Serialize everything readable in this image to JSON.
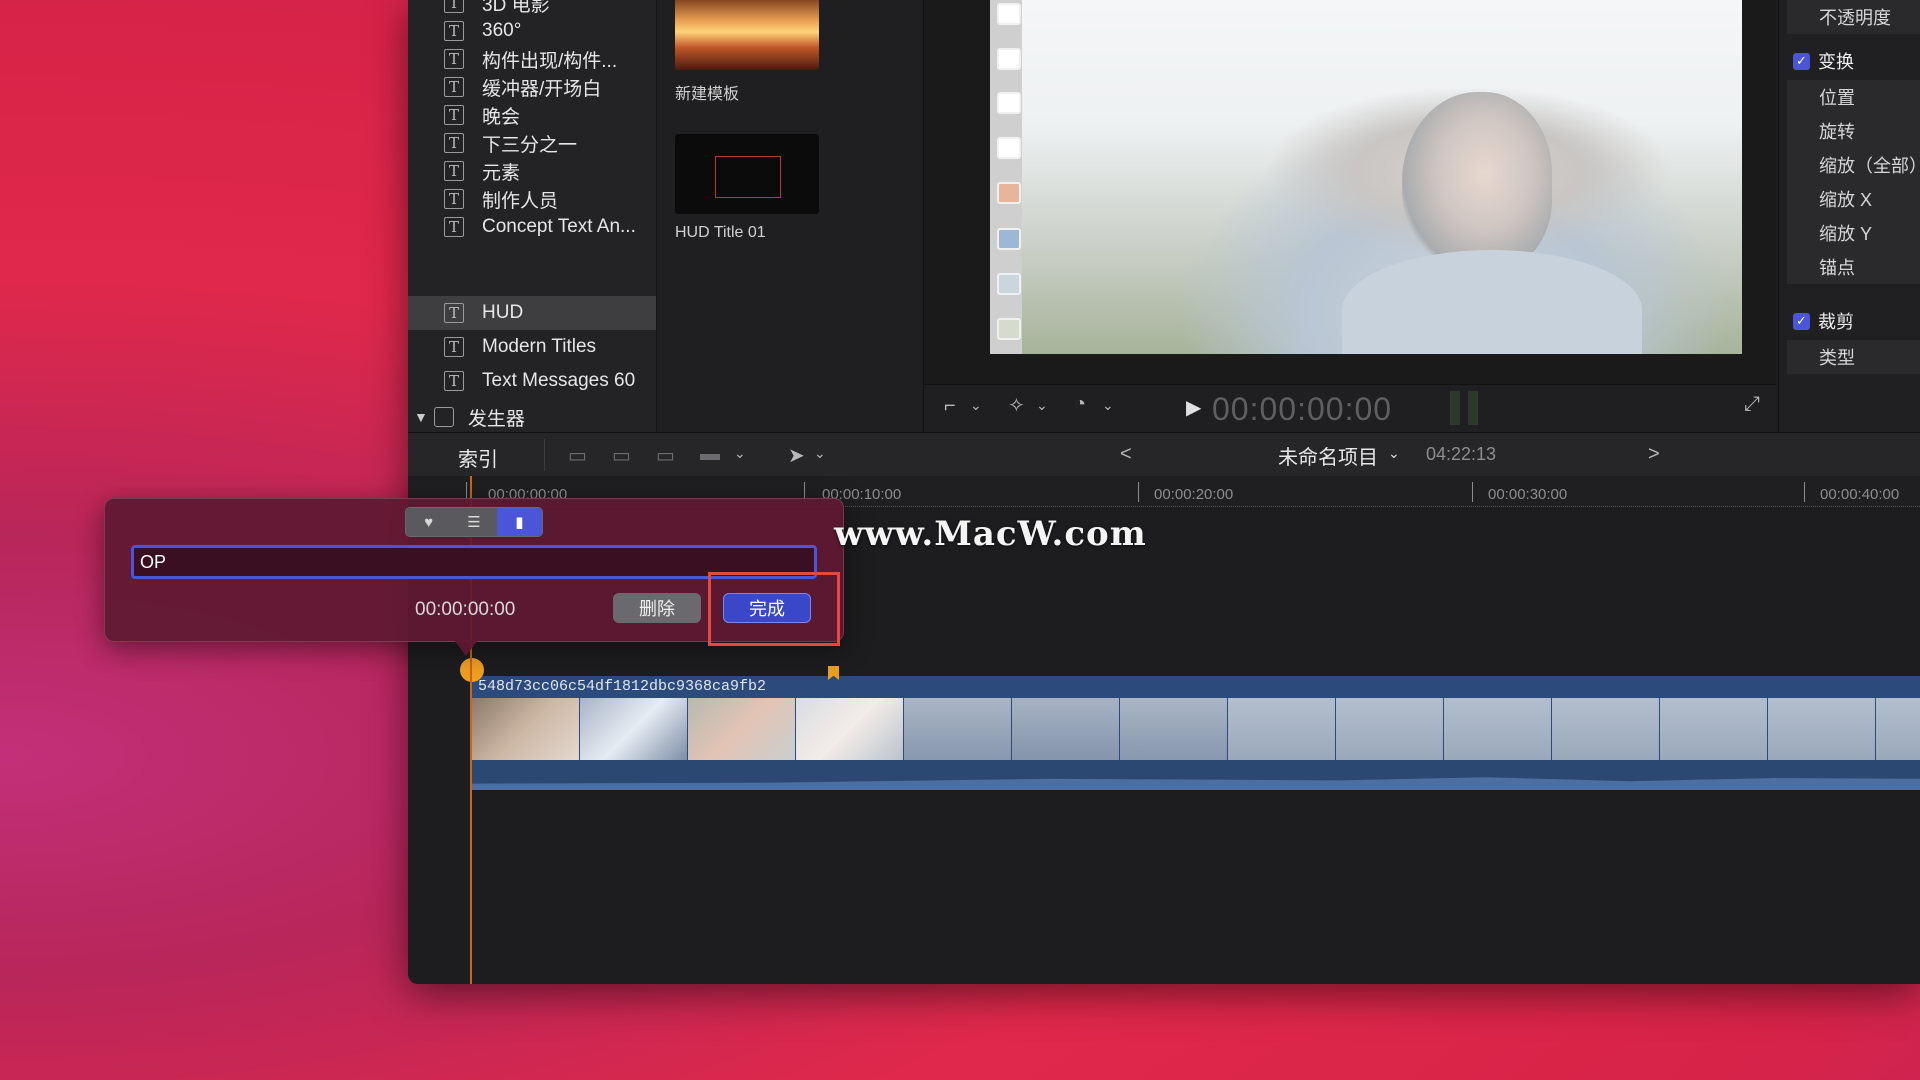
{
  "sidebar": {
    "items": [
      {
        "label": "3D 电影",
        "selected": false
      },
      {
        "label": "360°",
        "selected": false
      },
      {
        "label": "构件出现/构件...",
        "selected": false
      },
      {
        "label": "缓冲器/开场白",
        "selected": false
      },
      {
        "label": "晚会",
        "selected": false
      },
      {
        "label": "下三分之一",
        "selected": false
      },
      {
        "label": "元素",
        "selected": false
      },
      {
        "label": "制作人员",
        "selected": false
      },
      {
        "label": "Concept Text An...",
        "selected": false
      },
      {
        "label": "HUD",
        "selected": true
      },
      {
        "label": "Modern Titles",
        "selected": false
      },
      {
        "label": "Text Messages 60",
        "selected": false
      }
    ],
    "generators_label": "发生器"
  },
  "browser": {
    "templates": [
      {
        "label": "新建模板"
      },
      {
        "label": "HUD Title 01"
      }
    ]
  },
  "viewer": {
    "timecode": "00:00:00:00"
  },
  "inspector": {
    "opacity_label": "不透明度",
    "transform": {
      "label": "变换",
      "checked": true,
      "rows": [
        "位置",
        "旋转",
        "缩放（全部）",
        "缩放 X",
        "缩放 Y",
        "锚点"
      ]
    },
    "crop": {
      "label": "裁剪",
      "checked": true,
      "rows": [
        "类型"
      ]
    }
  },
  "timeline_toolbar": {
    "index_label": "索引",
    "prev_symbol": "<",
    "next_symbol": ">",
    "project_title": "未命名项目",
    "project_duration": "04:22:13"
  },
  "ruler": {
    "ticks": [
      "00:00:00:00",
      "00:00:10:00",
      "00:00:20:00",
      "00:00:30:00",
      "00:00:40:00"
    ]
  },
  "clip": {
    "name": "548d73cc06c54df1812dbc9368ca9fb2"
  },
  "marker_popover": {
    "tabs": [
      "marker",
      "todo",
      "chapter"
    ],
    "active_tab": "chapter",
    "name_value": "OP",
    "time": "00:00:00:00",
    "delete_label": "删除",
    "done_label": "完成"
  },
  "watermark": "www.MacW.com",
  "colors": {
    "accent": "#4a55d8",
    "playhead": "#c9651d",
    "marker": "#f0a020",
    "highlight": "#e4483e",
    "clip": "#2c4b7c"
  }
}
